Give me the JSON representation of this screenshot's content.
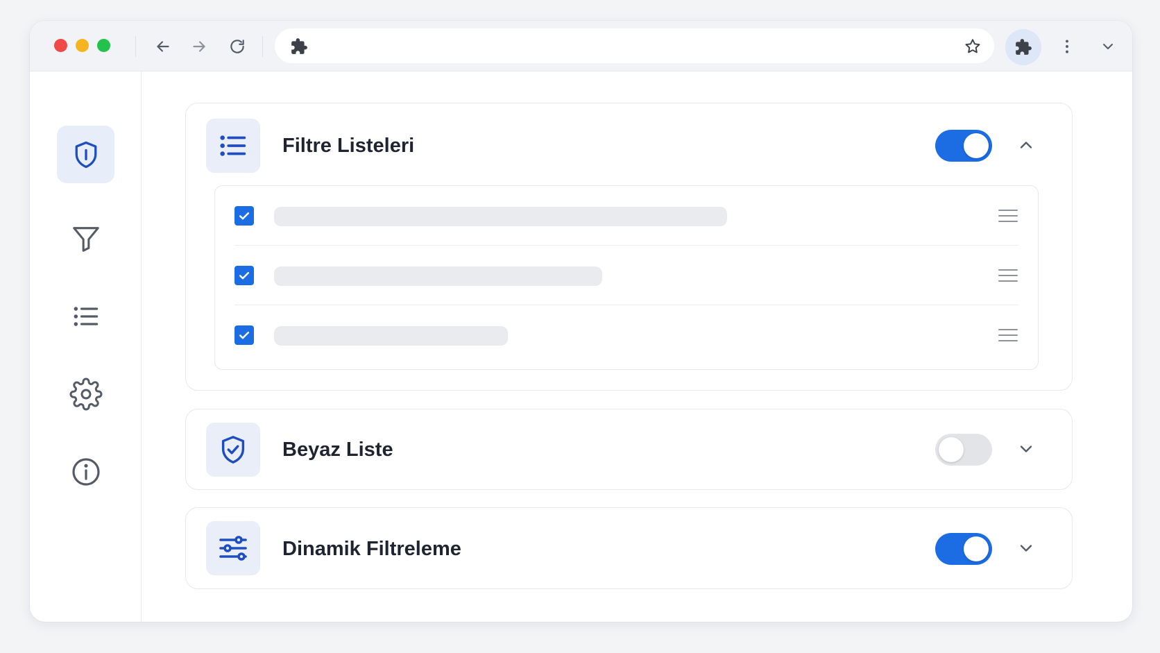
{
  "window": {
    "toolbar": {
      "traffic_lights": [
        "close",
        "minimize",
        "maximize"
      ],
      "nav_icons": [
        "arrow-left-icon",
        "arrow-right-icon",
        "reload-icon"
      ],
      "omnibox_icon": "puzzle-icon",
      "bookmark_icon": "star-icon",
      "extensions_icon": "puzzle-icon",
      "menu_icon": "more-vertical-icon",
      "dropdown_icon": "chevron-down-icon"
    },
    "sidebar": {
      "items": [
        {
          "icon": "shield-icon",
          "active": true
        },
        {
          "icon": "filter-icon",
          "active": false
        },
        {
          "icon": "list-icon",
          "active": false
        },
        {
          "icon": "gear-icon",
          "active": false
        },
        {
          "icon": "info-icon",
          "active": false
        }
      ]
    },
    "sections": [
      {
        "title": "Filtre Listeleri",
        "icon": "list-icon",
        "enabled": true,
        "expanded": true,
        "items": [
          {
            "checked": true,
            "label": ""
          },
          {
            "checked": true,
            "label": ""
          },
          {
            "checked": true,
            "label": ""
          }
        ]
      },
      {
        "title": "Beyaz Liste",
        "icon": "shield-check-icon",
        "enabled": false,
        "expanded": false
      },
      {
        "title": "Dinamik Filtreleme",
        "icon": "sliders-icon",
        "enabled": true,
        "expanded": false
      }
    ],
    "colors": {
      "accent": "#1c6ce4",
      "icon_blue": "#1f4fbf",
      "toggle_off": "#e2e4e8"
    }
  }
}
